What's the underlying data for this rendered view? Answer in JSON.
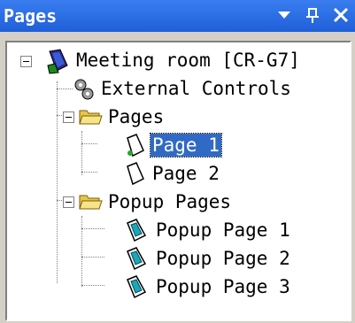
{
  "panel": {
    "title": "Pages",
    "buttons": {
      "menu": "dropdown-arrow-icon",
      "pin": "pin-icon",
      "close": "close-icon"
    }
  },
  "tree": {
    "root": {
      "label": "Meeting room [CR-G7]",
      "icon": "panel-device-icon",
      "expanded": true
    },
    "external_controls": {
      "label": "External Controls",
      "icon": "gears-icon"
    },
    "pages": {
      "label": "Pages",
      "icon": "folder-open-icon",
      "expanded": true,
      "items": [
        {
          "label": "Page 1",
          "icon": "page-icon",
          "selected": true
        },
        {
          "label": "Page 2",
          "icon": "page-icon",
          "selected": false
        }
      ]
    },
    "popup_pages": {
      "label": "Popup Pages",
      "icon": "folder-open-icon",
      "expanded": true,
      "items": [
        {
          "label": "Popup Page 1",
          "icon": "popup-page-icon"
        },
        {
          "label": "Popup Page 2",
          "icon": "popup-page-icon"
        },
        {
          "label": "Popup Page 3",
          "icon": "popup-page-icon"
        }
      ]
    }
  },
  "colors": {
    "title_bar": "#2a6fe6",
    "selection": "#316ac5"
  }
}
